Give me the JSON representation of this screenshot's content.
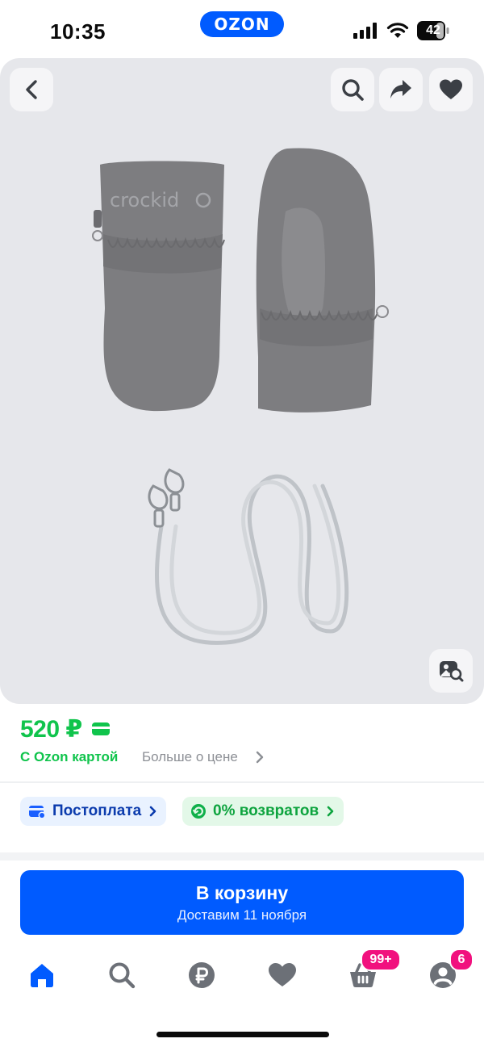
{
  "status_bar": {
    "time": "10:35",
    "brand": "OZON",
    "battery": "42",
    "icons": [
      "signal-icon",
      "wifi-icon",
      "battery-icon"
    ]
  },
  "gallery": {
    "buttons": [
      "back-icon",
      "search-icon",
      "share-icon",
      "heart-icon",
      "image-search-icon"
    ],
    "product_brand_print": "crockid",
    "background_color": "#e6e7eb"
  },
  "price": {
    "value": "520 ₽",
    "card_label": "С Ozon картой",
    "more_label": "Больше о цене",
    "color": "#10c44c"
  },
  "chips": {
    "postpay": "Постоплата",
    "returns": "0% возвратов"
  },
  "cart_button": {
    "label": "В корзину",
    "delivery": "Доставим 11 ноября",
    "color": "#005bff"
  },
  "tabbar": {
    "items": [
      "home-icon",
      "search-icon",
      "ruble-icon",
      "heart-icon",
      "basket-icon",
      "profile-icon"
    ],
    "active": "home-icon",
    "cart_badge": "99+",
    "profile_badge": "6",
    "badge_color": "#f1117e"
  }
}
